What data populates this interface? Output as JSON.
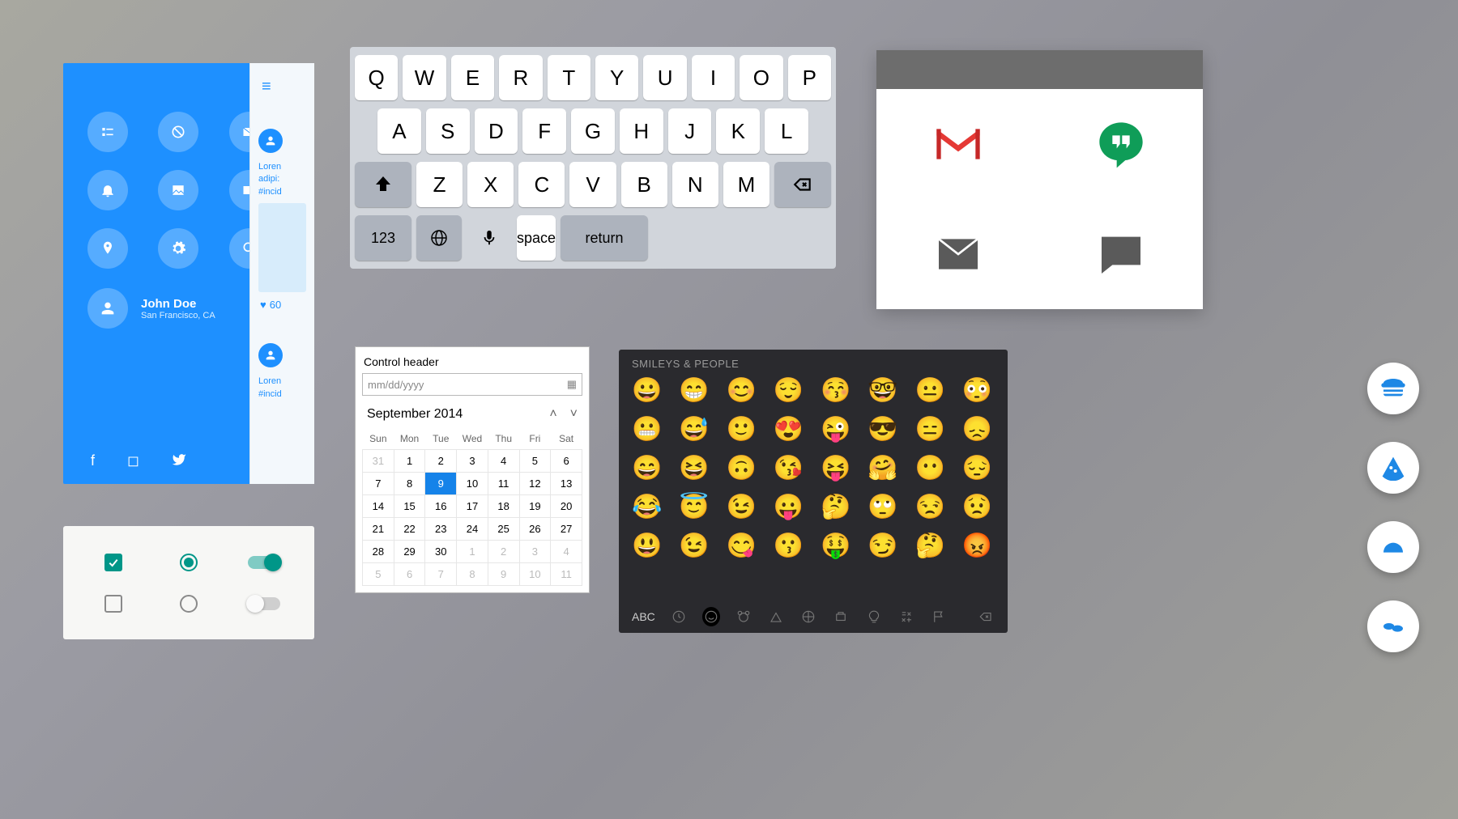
{
  "blue_panel": {
    "username": "John Doe",
    "location": "San Francisco, CA",
    "icons": [
      "list",
      "block",
      "mail",
      "bell",
      "image",
      "video",
      "pin",
      "settings",
      "search"
    ],
    "social": [
      "facebook",
      "instagram",
      "twitter"
    ]
  },
  "feed": {
    "line1": "Loren",
    "line2": "adipi:",
    "line3": "#incid",
    "likes": "60"
  },
  "keyboard": {
    "row1": [
      "Q",
      "W",
      "E",
      "R",
      "T",
      "Y",
      "U",
      "I",
      "O",
      "P"
    ],
    "row2": [
      "A",
      "S",
      "D",
      "F",
      "G",
      "H",
      "J",
      "K",
      "L"
    ],
    "row3": [
      "Z",
      "X",
      "C",
      "V",
      "B",
      "N",
      "M"
    ],
    "shift": "⇧",
    "backspace": "⌫",
    "numbers": "123",
    "globe": "globe",
    "mic": "mic",
    "space": "space",
    "return": "return"
  },
  "apps": {
    "items": [
      "Gmail",
      "Hangouts",
      "Email",
      "Messages"
    ]
  },
  "controls": {
    "checkbox_checked": true,
    "radio_checked": true,
    "switch_on": true,
    "checkbox_unchecked": false,
    "radio_unchecked": false,
    "switch_off": false
  },
  "calendar": {
    "control_header": "Control header",
    "placeholder": "mm/dd/yyyy",
    "month_label": "September 2014",
    "weekdays": [
      "Sun",
      "Mon",
      "Tue",
      "Wed",
      "Thu",
      "Fri",
      "Sat"
    ],
    "grid": [
      [
        {
          "d": "31",
          "dim": true
        },
        {
          "d": "1"
        },
        {
          "d": "2"
        },
        {
          "d": "3"
        },
        {
          "d": "4"
        },
        {
          "d": "5"
        },
        {
          "d": "6"
        }
      ],
      [
        {
          "d": "7"
        },
        {
          "d": "8"
        },
        {
          "d": "9",
          "sel": true
        },
        {
          "d": "10"
        },
        {
          "d": "11"
        },
        {
          "d": "12"
        },
        {
          "d": "13"
        }
      ],
      [
        {
          "d": "14"
        },
        {
          "d": "15"
        },
        {
          "d": "16"
        },
        {
          "d": "17"
        },
        {
          "d": "18"
        },
        {
          "d": "19"
        },
        {
          "d": "20"
        }
      ],
      [
        {
          "d": "21"
        },
        {
          "d": "22"
        },
        {
          "d": "23"
        },
        {
          "d": "24"
        },
        {
          "d": "25"
        },
        {
          "d": "26"
        },
        {
          "d": "27"
        }
      ],
      [
        {
          "d": "28"
        },
        {
          "d": "29"
        },
        {
          "d": "30"
        },
        {
          "d": "1",
          "dim": true
        },
        {
          "d": "2",
          "dim": true
        },
        {
          "d": "3",
          "dim": true
        },
        {
          "d": "4",
          "dim": true
        }
      ],
      [
        {
          "d": "5",
          "dim": true
        },
        {
          "d": "6",
          "dim": true
        },
        {
          "d": "7",
          "dim": true
        },
        {
          "d": "8",
          "dim": true
        },
        {
          "d": "9",
          "dim": true
        },
        {
          "d": "10",
          "dim": true
        },
        {
          "d": "11",
          "dim": true
        }
      ]
    ]
  },
  "emoji": {
    "title": "Smileys & People",
    "abc": "ABC",
    "rows": [
      [
        "😀",
        "😁",
        "😊",
        "😌",
        "😚",
        "🤓",
        "😐",
        "😳"
      ],
      [
        "😬",
        "😅",
        "🙂",
        "😍",
        "😜",
        "😎",
        "😑",
        "😞"
      ],
      [
        "😄",
        "😆",
        "🙃",
        "😘",
        "😝",
        "🤗",
        "😶",
        "😔"
      ],
      [
        "😂",
        "😇",
        "😉",
        "😛",
        "🤔",
        "🙄",
        "😒",
        "😟"
      ],
      [
        "😃",
        "😉",
        "😋",
        "😗",
        "🤑",
        "😏",
        "🤔",
        "😡"
      ]
    ],
    "tabs": [
      "recent",
      "smileys",
      "animals",
      "food",
      "activity",
      "travel",
      "objects",
      "symbols",
      "flags"
    ]
  },
  "fabs": [
    "burger",
    "pizza",
    "taco",
    "sushi"
  ]
}
